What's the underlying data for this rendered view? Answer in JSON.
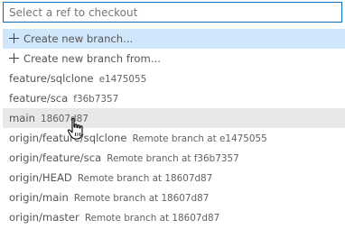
{
  "search": {
    "placeholder": "Select a ref to checkout",
    "value": ""
  },
  "actions": [
    {
      "label": "Create new branch...",
      "icon": "plus-icon"
    },
    {
      "label": "Create new branch from...",
      "icon": "plus-icon"
    }
  ],
  "refs": [
    {
      "name": "feature/sqlclone",
      "description": "e1475055"
    },
    {
      "name": "feature/sca",
      "description": "f36b7357"
    },
    {
      "name": "main",
      "description": "18607d87"
    },
    {
      "name": "origin/feature/sqlclone",
      "description": "Remote branch at e1475055"
    },
    {
      "name": "origin/feature/sca",
      "description": "Remote branch at f36b7357"
    },
    {
      "name": "origin/HEAD",
      "description": "Remote branch at 18607d87"
    },
    {
      "name": "origin/main",
      "description": "Remote branch at 18607d87"
    },
    {
      "name": "origin/master",
      "description": "Remote branch at 18607d87"
    }
  ],
  "colors": {
    "focus_border": "#0a6fc2",
    "active_item": "#cfe6fb",
    "hover_item": "#e8e8e8"
  },
  "cursor": "hand-pointer-icon"
}
